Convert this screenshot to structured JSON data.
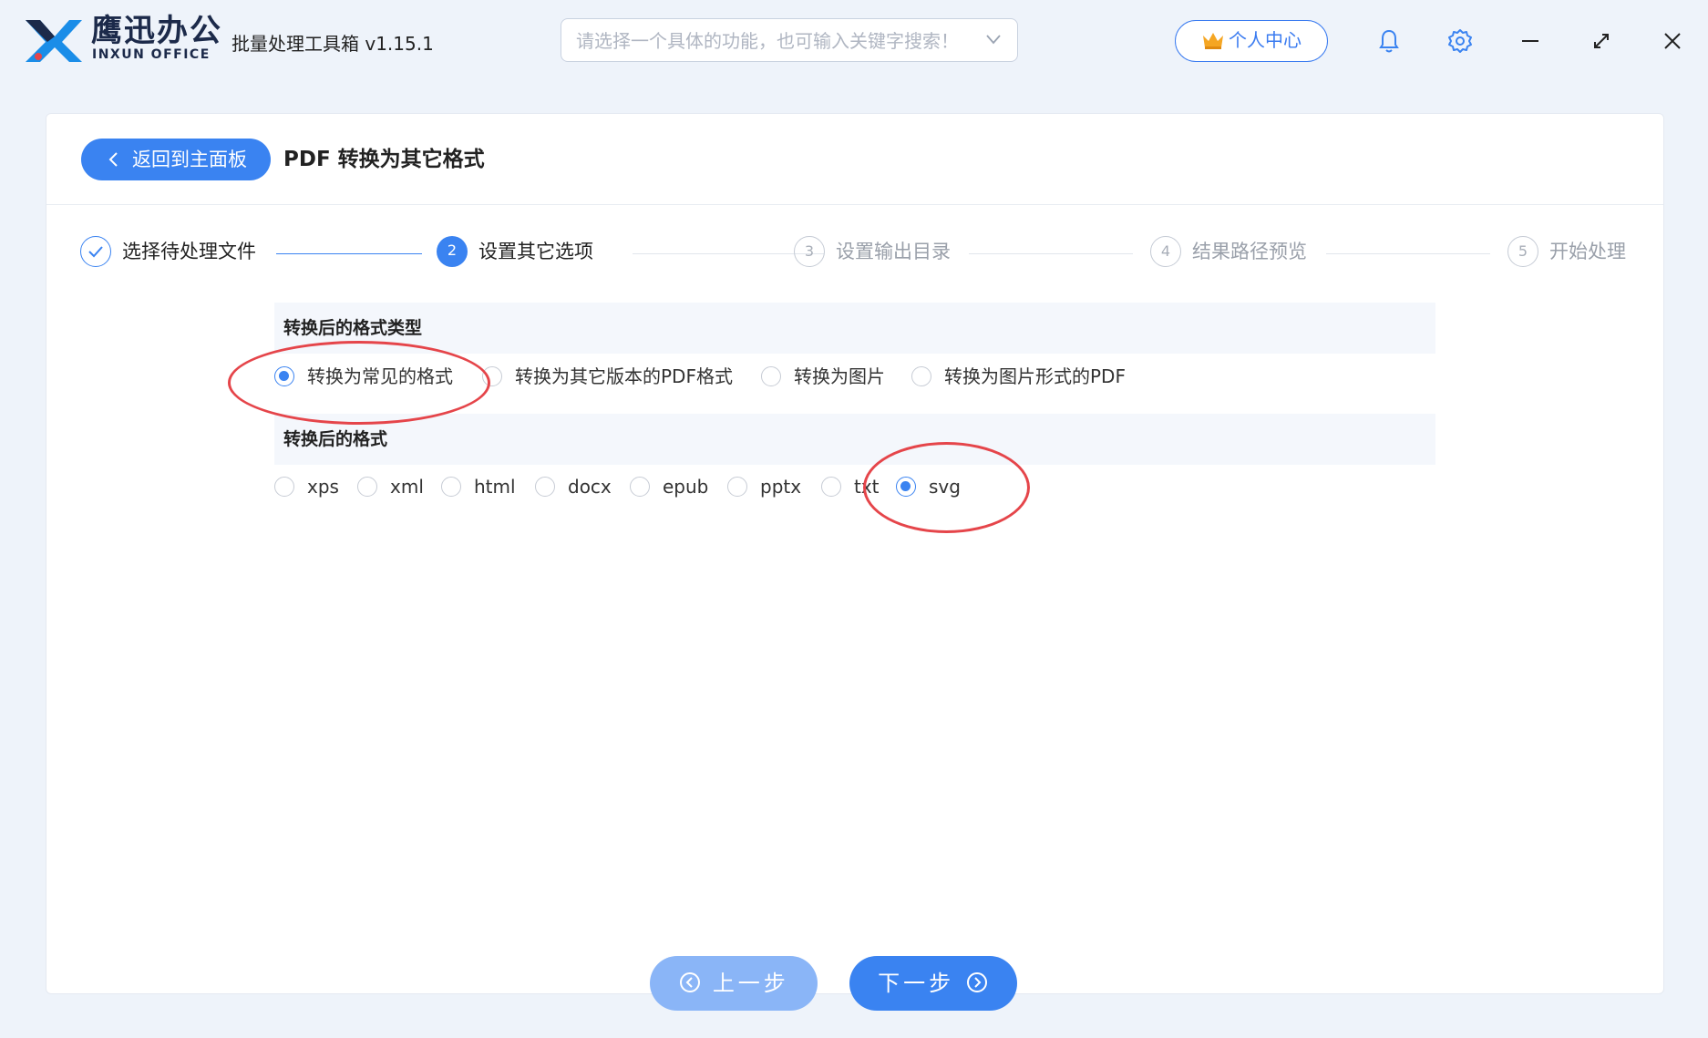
{
  "titlebar": {
    "brand_cn": "鹰迅办公",
    "brand_en": "INXUN OFFICE",
    "app_title": "批量处理工具箱 v1.15.1",
    "search_placeholder": "请选择一个具体的功能，也可输入关键字搜索！",
    "user_center": "个人中心",
    "icons": [
      "bell-icon",
      "gear-icon",
      "minimize-icon",
      "maximize-icon",
      "close-icon"
    ]
  },
  "header": {
    "back_label": "返回到主面板",
    "page_title": "PDF 转换为其它格式"
  },
  "steps": [
    {
      "num": "",
      "label": "选择待处理文件",
      "state": "done"
    },
    {
      "num": "2",
      "label": "设置其它选项",
      "state": "active"
    },
    {
      "num": "3",
      "label": "设置输出目录",
      "state": "todo"
    },
    {
      "num": "4",
      "label": "结果路径预览",
      "state": "todo"
    },
    {
      "num": "5",
      "label": "开始处理",
      "state": "todo"
    }
  ],
  "sections": {
    "type_title": "转换后的格式类型",
    "type_options": [
      {
        "label": "转换为常见的格式",
        "checked": true
      },
      {
        "label": "转换为其它版本的PDF格式",
        "checked": false
      },
      {
        "label": "转换为图片",
        "checked": false
      },
      {
        "label": "转换为图片形式的PDF",
        "checked": false
      }
    ],
    "format_title": "转换后的格式",
    "format_options": [
      {
        "label": "xps",
        "checked": false
      },
      {
        "label": "xml",
        "checked": false
      },
      {
        "label": "html",
        "checked": false
      },
      {
        "label": "docx",
        "checked": false
      },
      {
        "label": "epub",
        "checked": false
      },
      {
        "label": "pptx",
        "checked": false
      },
      {
        "label": "txt",
        "checked": false
      },
      {
        "label": "svg",
        "checked": true
      }
    ]
  },
  "nav": {
    "prev_label": "上一步",
    "next_label": "下一步"
  },
  "colors": {
    "accent": "#3a83f1",
    "annotation": "#e5454a"
  }
}
